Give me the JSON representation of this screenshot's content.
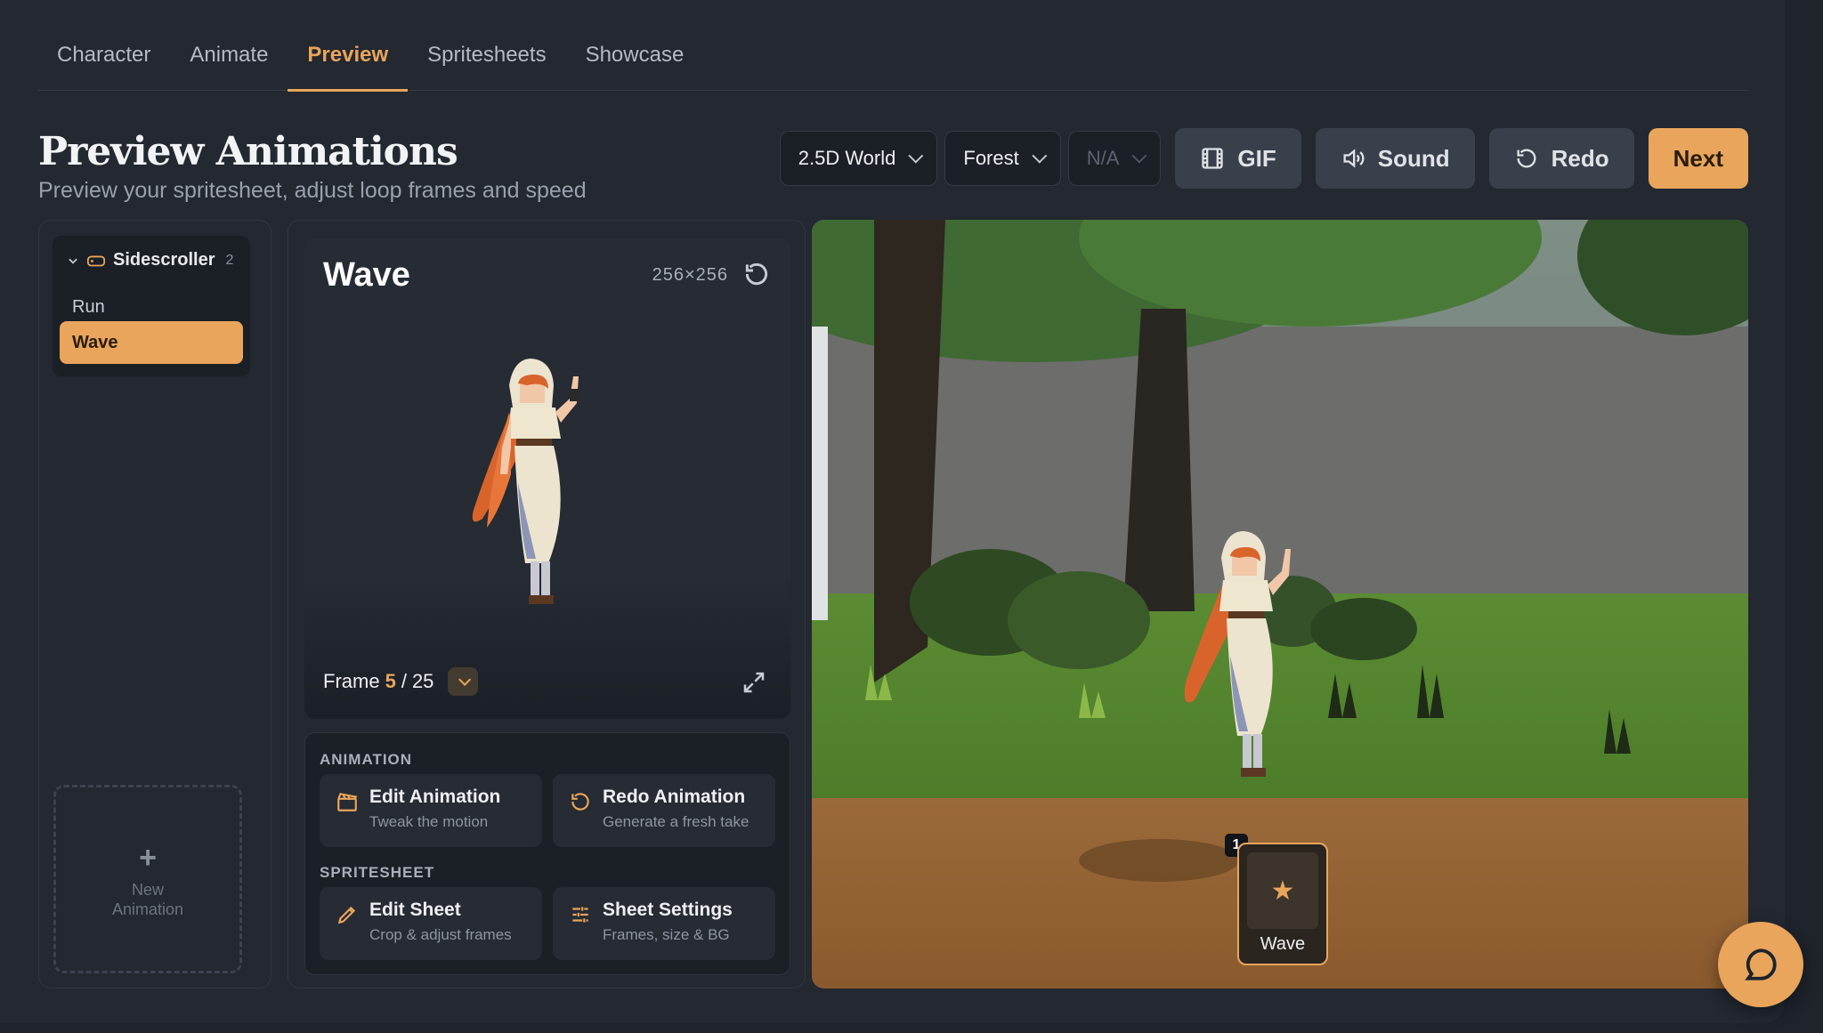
{
  "tabs": [
    {
      "label": "Character"
    },
    {
      "label": "Animate"
    },
    {
      "label": "Preview",
      "active": true
    },
    {
      "label": "Spritesheets"
    },
    {
      "label": "Showcase"
    }
  ],
  "header": {
    "title": "Preview Animations",
    "subtitle": "Preview your spritesheet, adjust loop frames and speed"
  },
  "controls": {
    "world_select": "2.5D World",
    "environment_select": "Forest",
    "third_select": "N/A",
    "gif_label": "GIF",
    "sound_label": "Sound",
    "redo_label": "Redo",
    "next_label": "Next"
  },
  "animation_list": {
    "group_name": "Sidescroller",
    "group_count": "2",
    "items": [
      {
        "label": "Run"
      },
      {
        "label": "Wave",
        "selected": true
      }
    ],
    "new_label_1": "New",
    "new_label_2": "Animation"
  },
  "preview": {
    "title": "Wave",
    "dimensions": "256×256",
    "frame_label": "Frame",
    "frame_current": "5",
    "frame_separator": "/",
    "frame_total": "25"
  },
  "actions": {
    "animation_section": "ANIMATION",
    "spritesheet_section": "SPRITESHEET",
    "edit_animation": {
      "title": "Edit Animation",
      "subtitle": "Tweak the motion"
    },
    "redo_animation": {
      "title": "Redo Animation",
      "subtitle": "Generate a fresh take"
    },
    "edit_sheet": {
      "title": "Edit Sheet",
      "subtitle": "Crop & adjust frames"
    },
    "sheet_settings": {
      "title": "Sheet Settings",
      "subtitle": "Frames, size & BG"
    }
  },
  "scene": {
    "slot_number": "1",
    "slot_label": "Wave",
    "slot_icon": "star-icon"
  },
  "colors": {
    "accent": "#e8a55b",
    "background": "#1e232c",
    "panel": "#232831"
  }
}
